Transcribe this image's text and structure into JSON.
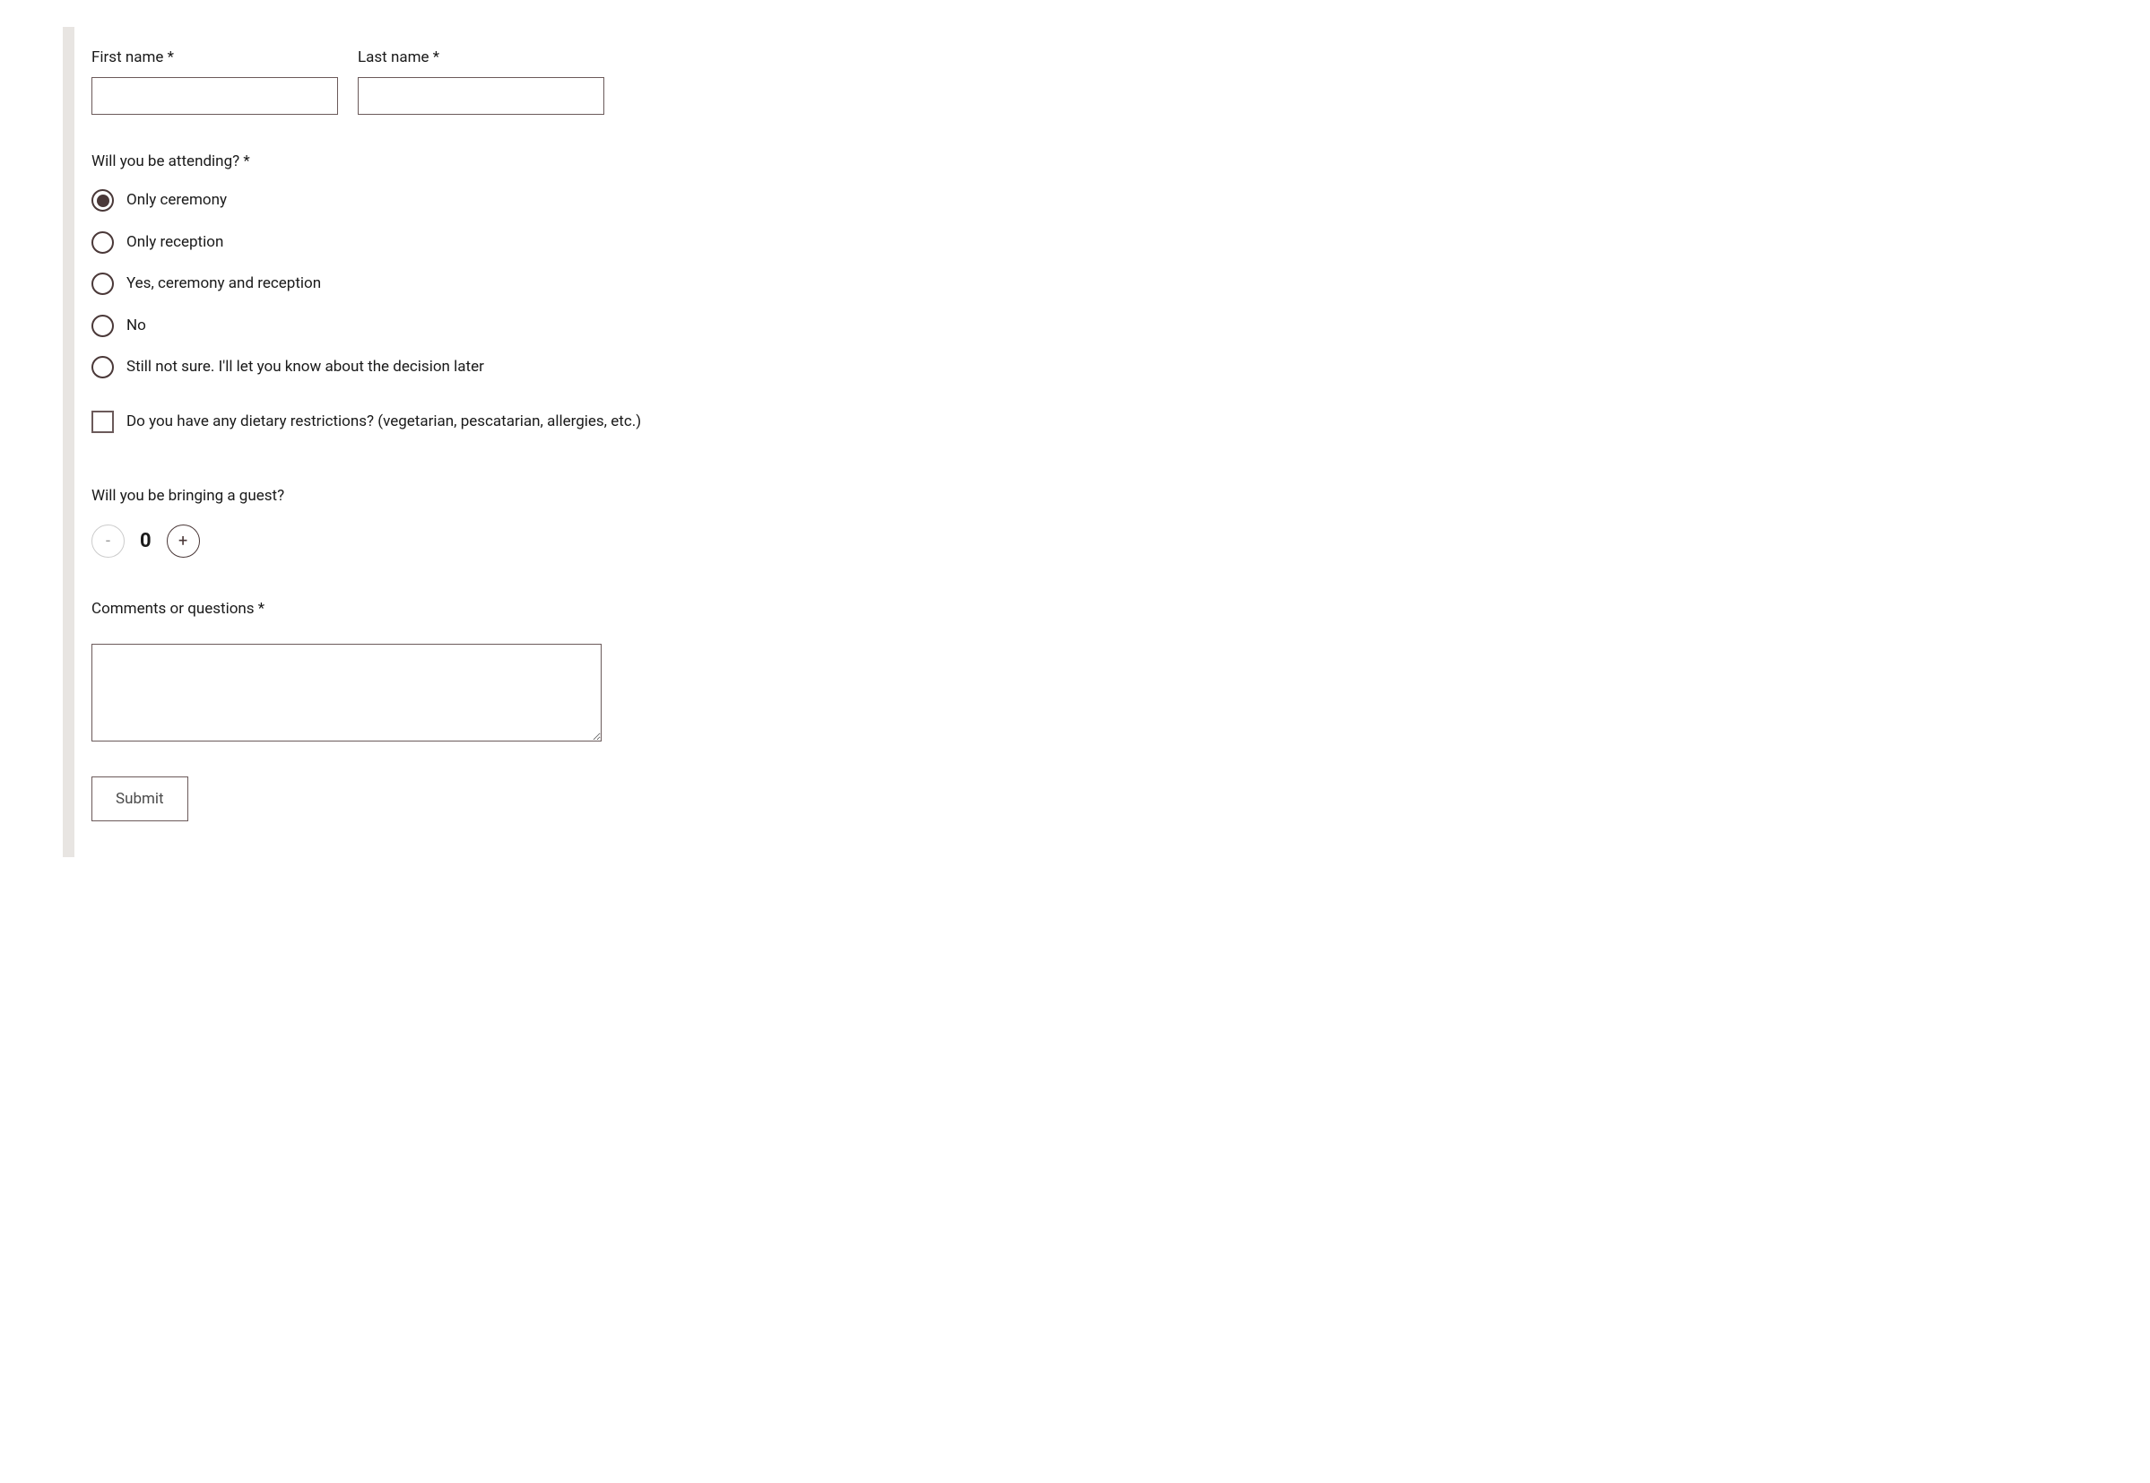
{
  "firstName": {
    "label": "First name *",
    "value": ""
  },
  "lastName": {
    "label": "Last name *",
    "value": ""
  },
  "attending": {
    "question": "Will you be attending? *",
    "options": [
      {
        "label": "Only ceremony",
        "selected": true
      },
      {
        "label": "Only reception",
        "selected": false
      },
      {
        "label": "Yes, ceremony and reception",
        "selected": false
      },
      {
        "label": "No",
        "selected": false
      },
      {
        "label": "Still not sure. I'll let you know about the decision later",
        "selected": false
      }
    ]
  },
  "dietary": {
    "label": "Do you have any dietary restrictions? (vegetarian, pescatarian, allergies, etc.)",
    "checked": false
  },
  "guest": {
    "question": "Will you be bringing a guest?",
    "value": "0",
    "minus": "-",
    "plus": "+"
  },
  "comments": {
    "label": "Comments or questions *",
    "value": ""
  },
  "submit": {
    "label": "Submit"
  }
}
